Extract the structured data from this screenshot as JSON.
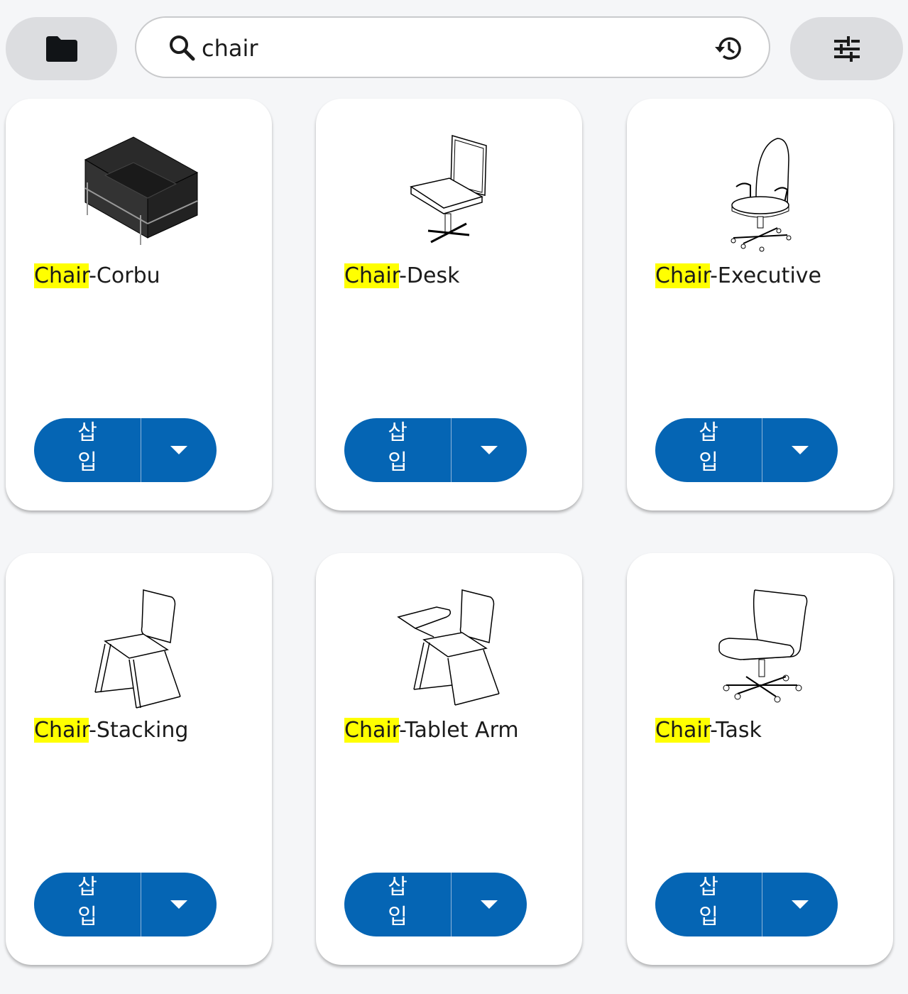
{
  "search": {
    "value": "chair",
    "icons": {
      "left": "search-icon",
      "right": "history-icon"
    }
  },
  "toolbar": {
    "folder_icon": "folder-icon",
    "filter_icon": "tune-icon"
  },
  "colors": {
    "accent": "#0565b4",
    "highlight": "#ffff00",
    "page_bg": "#f5f6f8",
    "pill_bg": "#dcdde0"
  },
  "cards": [
    {
      "match": "Chair",
      "rest": "-Corbu",
      "insert_label": "삽입",
      "thumb": "corbu-chair-image"
    },
    {
      "match": "Chair",
      "rest": "-Desk",
      "insert_label": "삽입",
      "thumb": "desk-chair-image"
    },
    {
      "match": "Chair",
      "rest": "-Executive",
      "insert_label": "삽입",
      "thumb": "executive-chair-image"
    },
    {
      "match": "Chair",
      "rest": "-Stacking",
      "insert_label": "삽입",
      "thumb": "stacking-chair-image"
    },
    {
      "match": "Chair",
      "rest": "-Tablet Arm",
      "insert_label": "삽입",
      "thumb": "tablet-arm-chair-image"
    },
    {
      "match": "Chair",
      "rest": "-Task",
      "insert_label": "삽입",
      "thumb": "task-chair-image"
    }
  ]
}
